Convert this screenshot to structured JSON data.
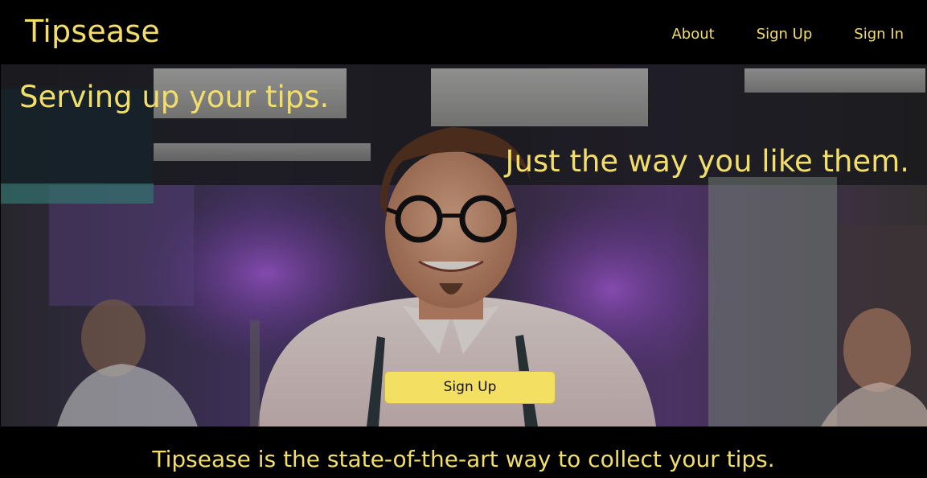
{
  "navbar": {
    "brand": "Tipsease",
    "links": [
      {
        "label": "About"
      },
      {
        "label": "Sign Up"
      },
      {
        "label": "Sign In"
      }
    ]
  },
  "hero": {
    "headline": "Serving up your tips.",
    "subline": "Just the way you like them.",
    "cta_label": "Sign Up"
  },
  "footer": {
    "tagline": "Tipsease is the state-of-the-art way to collect your tips."
  },
  "colors": {
    "accent": "#f2de6a",
    "button": "#f3df62",
    "background": "#000000"
  }
}
